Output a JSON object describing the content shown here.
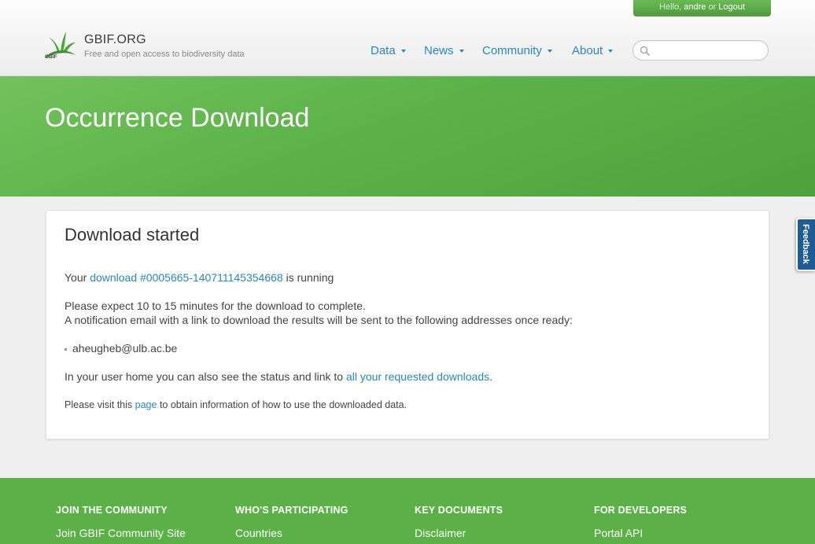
{
  "userbar": {
    "hello": "Hello,",
    "username": "andre",
    "or": "or",
    "logout": "Logout"
  },
  "brand": {
    "name": "GBIF.ORG",
    "tagline": "Free and open access to biodiversity data",
    "logo_text": "GBIF"
  },
  "nav": {
    "items": [
      {
        "label": "Data"
      },
      {
        "label": "News"
      },
      {
        "label": "Community"
      },
      {
        "label": "About"
      }
    ]
  },
  "search": {
    "value": "",
    "placeholder": ""
  },
  "hero": {
    "title": "Occurrence Download"
  },
  "card": {
    "title": "Download started",
    "line1_prefix": "Your",
    "download_link": "download #0005665-140711145354668",
    "line1_suffix": "is running",
    "expect": "Please expect 10 to 15 minutes for the download to complete.",
    "notify": "A notification email with a link to download the results will be sent to the following addresses once ready:",
    "email": "aheugheb@ulb.ac.be",
    "userhome_prefix": "In your user home you can also see the status and link to",
    "userhome_link": "all your requested downloads",
    "userhome_suffix": ".",
    "visit_prefix": "Please visit this",
    "visit_link": "page",
    "visit_suffix": "to obtain information of how to use the downloaded data."
  },
  "feedback": {
    "label": "Feedback"
  },
  "footer": {
    "columns": [
      {
        "heading": "JOIN THE COMMUNITY",
        "link": "Join GBIF Community Site"
      },
      {
        "heading": "WHO'S PARTICIPATING",
        "link": "Countries"
      },
      {
        "heading": "KEY DOCUMENTS",
        "link": "Disclaimer"
      },
      {
        "heading": "FOR DEVELOPERS",
        "link": "Portal API"
      }
    ]
  },
  "colors": {
    "brand_green": "#5cb048",
    "link_blue": "#2a86c0",
    "feedback_blue": "#1f5c95"
  },
  "icons": {
    "logo": "gbif-leaf-logo",
    "search": "search-icon",
    "caret": "chevron-down-icon"
  }
}
